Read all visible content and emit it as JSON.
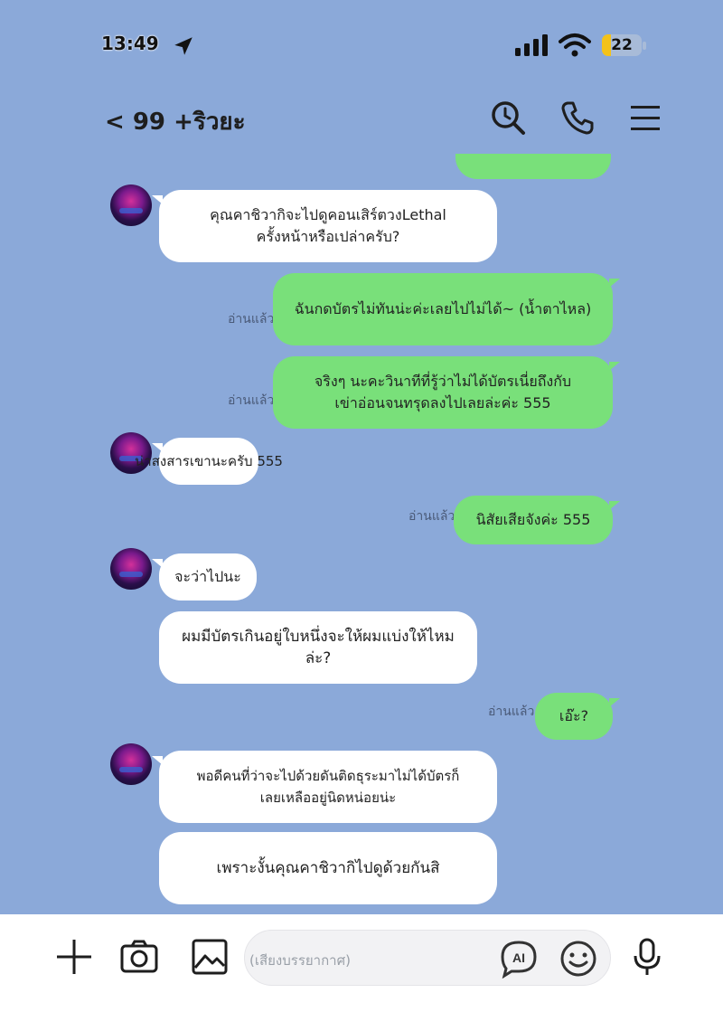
{
  "status_bar": {
    "time": "13:49",
    "battery": "22"
  },
  "header": {
    "back_label": "< 99 +ริวยะ",
    "icons": [
      "search-icon",
      "phone-icon",
      "menu-icon"
    ]
  },
  "messages": [
    {
      "side": "in",
      "text": "คุณคาชิวากิจะไปดูคอนเสิร์ตวงLethal\nครั้งหน้าหรือเปล่าครับ?"
    },
    {
      "side": "out",
      "read": "อ่านแล้ว",
      "text": "ฉันกดบัตรไม่ทันน่ะค่ะเลยไปไม่ได้~ (น้ำตาไหล)"
    },
    {
      "side": "out",
      "read": "อ่านแล้ว",
      "text": "จริงๆ นะคะวินาทีที่รู้ว่าไม่ได้บัตรเนี่ยถึงกับ\nเข่าอ่อนจนทรุดลงไปเลยล่ะค่ะ 555"
    },
    {
      "side": "in",
      "text": "น่าสงสารเขานะครับ 555"
    },
    {
      "side": "out",
      "read": "อ่านแล้ว",
      "text": "นิสัยเสียจังค่ะ 555"
    },
    {
      "side": "in",
      "text": "จะว่าไปนะ"
    },
    {
      "side": "in",
      "text": "ผมมีบัตรเกินอยู่ใบหนึ่งจะให้ผมแบ่งให้ไหมล่ะ?"
    },
    {
      "side": "out",
      "read": "อ่านแล้ว",
      "text": "เอ๊ะ?"
    },
    {
      "side": "in",
      "text": "พอดีคนที่ว่าจะไปด้วยดันติดธุระมาไม่ได้บัตรก็\nเลยเหลืออยู่นิดหน่อยน่ะ"
    },
    {
      "side": "in",
      "text": "เพราะงั้นคุณคาชิวากิไปดูด้วยกันสิ"
    }
  ],
  "input_bar": {
    "placeholder": "(เสียงบรรยากาศ)",
    "icons": [
      "plus-icon",
      "camera-icon",
      "image-icon",
      "ai-icon",
      "emoji-icon",
      "microphone-icon"
    ]
  },
  "colors": {
    "background": "#8ba9d9",
    "outgoing_bubble": "#79e07a",
    "incoming_bubble": "#ffffff"
  }
}
